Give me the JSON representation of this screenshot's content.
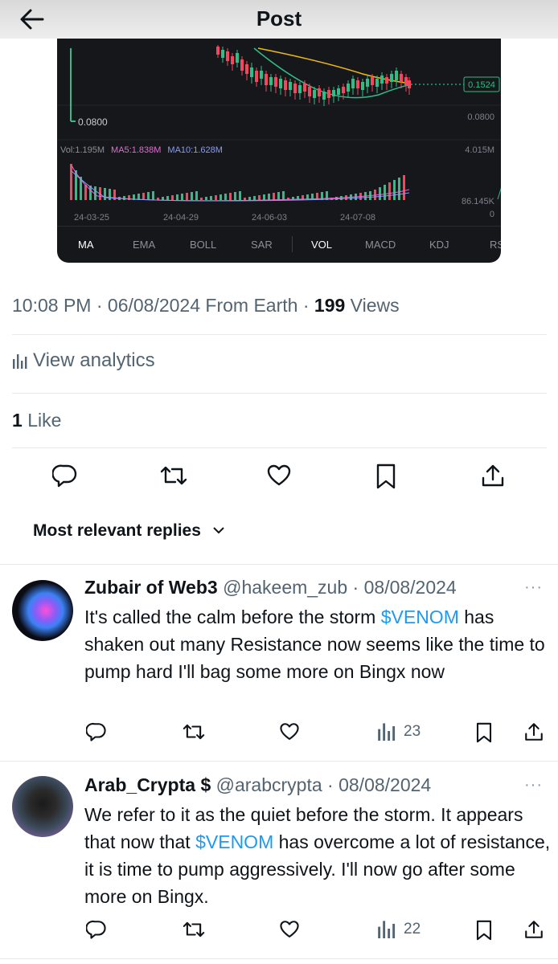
{
  "header": {
    "title": "Post",
    "back_icon": "arrow-left-icon"
  },
  "chart": {
    "price_label": "0.1524",
    "axis_right_price": "0.0800",
    "left_price_marker": "0.0800",
    "volume_legend": {
      "vol": "Vol:1.195M",
      "ma5": "MA5:1.838M",
      "ma10": "MA10:1.628M"
    },
    "volume_axis_top": "4.015M",
    "volume_axis_mid": "86.145K",
    "volume_axis_zero": "0",
    "dates": [
      "24-03-25",
      "24-04-29",
      "24-06-03",
      "24-07-08"
    ],
    "indicator_tabs": [
      "MA",
      "EMA",
      "BOLL",
      "SAR",
      "VOL",
      "MACD",
      "KDJ",
      "RS"
    ],
    "active_tabs": [
      "MA",
      "VOL"
    ],
    "colors": {
      "up": "#2ebd85",
      "down": "#f6465d",
      "ma_yellow": "#f0b90b",
      "ma_green": "#2ebd85",
      "ma5": "#e26ad4",
      "ma10": "#8a9cf0"
    }
  },
  "post_meta": {
    "time": "10:08 PM",
    "date": "06/08/2024",
    "source": "From Earth",
    "views_count": "199",
    "views_label": "Views"
  },
  "analytics": {
    "label": "View analytics"
  },
  "likes": {
    "count": "1",
    "label": "Like"
  },
  "actions": [
    "reply-icon",
    "retweet-icon",
    "heart-icon",
    "bookmark-icon",
    "share-icon"
  ],
  "replies_sort": {
    "label": "Most relevant replies"
  },
  "replies": [
    {
      "name": "Zubair of Web3",
      "handle": "@hakeem_zub",
      "date": "08/08/2024",
      "text_before": "It's called the calm before the storm ",
      "cashtag": "$VENOM",
      "text_after": " has shaken out many Resistance now seems like the time to pump hard I'll bag some more on Bingx now",
      "views": "23",
      "more": "···"
    },
    {
      "name": "Arab_Crypta",
      "name_badge": "$",
      "handle": "@arabcrypta",
      "date": "08/08/2024",
      "text_before": "We refer to it as the quiet before the storm. It appears that now that ",
      "cashtag": "$VENOM",
      "text_after": " has overcome a lot of resistance, it is time to pump aggressively. I'll now go after some more on Bingx.",
      "views": "22",
      "more": "···"
    }
  ]
}
